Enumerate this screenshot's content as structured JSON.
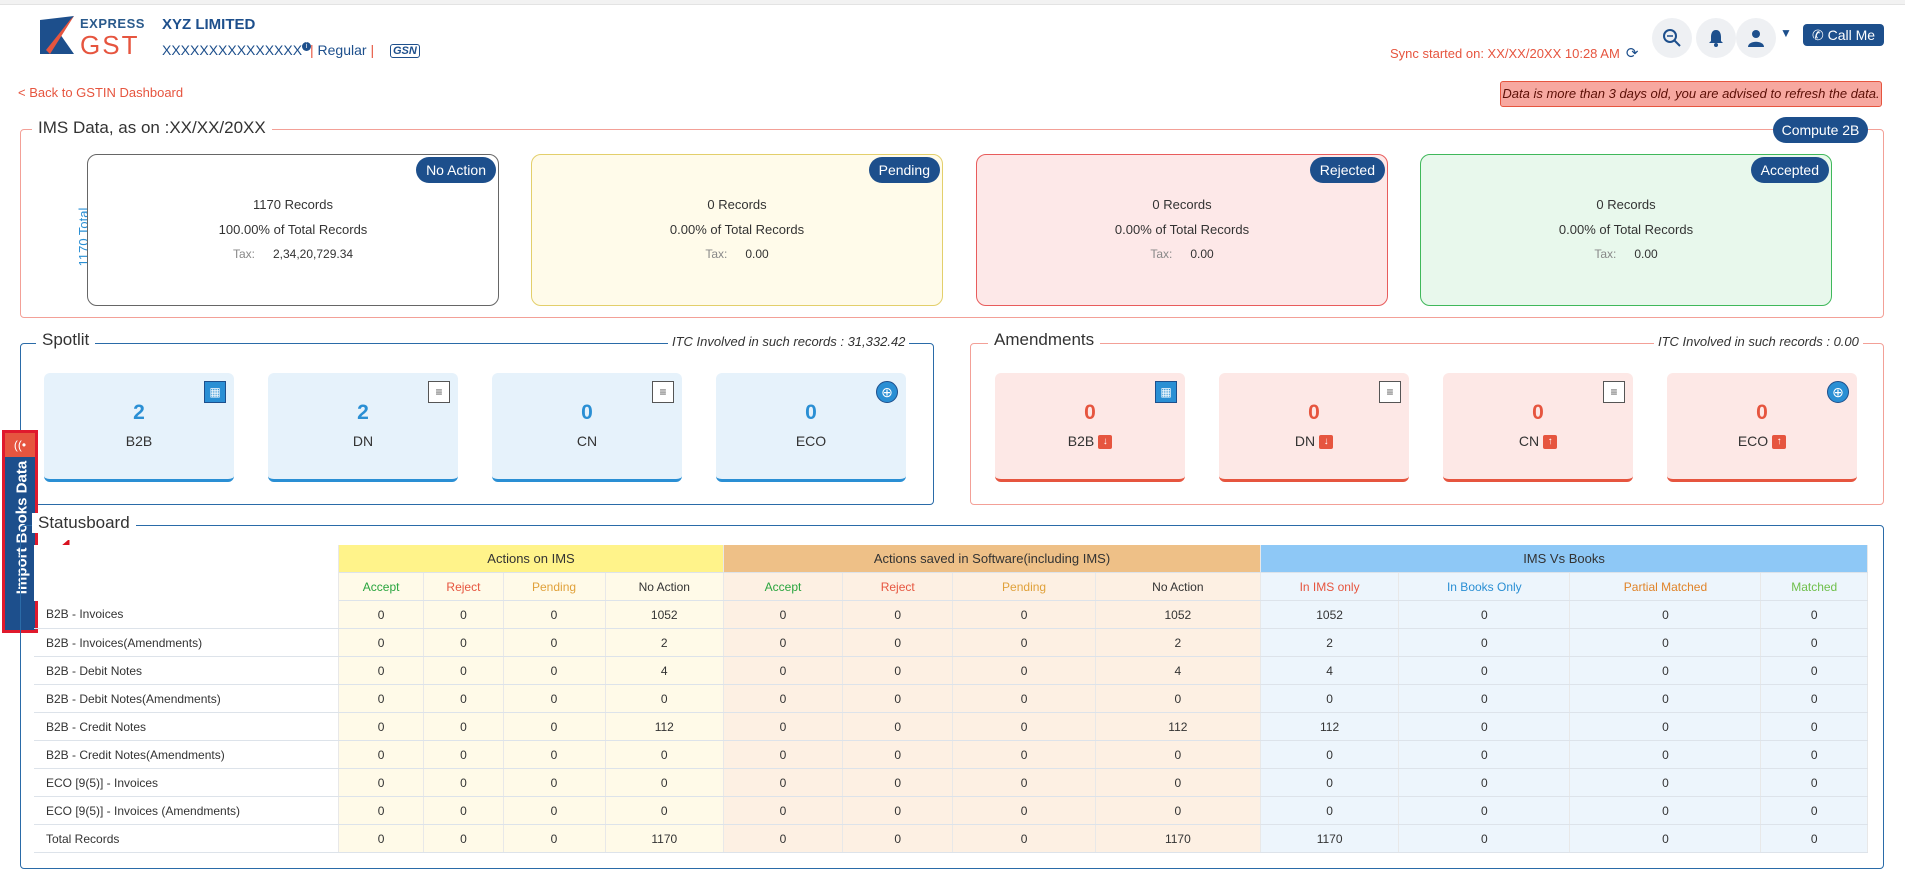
{
  "header": {
    "logo_top": "EXPRESS",
    "logo_bottom": "GST",
    "company": "XYZ LIMITED",
    "gstin": "XXXXXXXXXXXXXXX",
    "info_icon": "i",
    "sep": "|",
    "type": "Regular",
    "gsn_badge": "GSN",
    "sync": "Sync started on: XX/XX/20XX 10:28 AM",
    "icons": [
      "search-icon",
      "bell-icon",
      "user-icon",
      "chevron-down-icon"
    ],
    "call_label": "Call Me"
  },
  "back_link": "< Back to GSTIN Dashboard",
  "warning": "Data is more than 3 days old, you are advised to refresh the data.",
  "ims": {
    "title": "IMS Data, as on :XX/XX/20XX",
    "compute_label": "Compute 2B",
    "total_records": "1170 Total Records",
    "tax_label": "Tax:",
    "cards": [
      {
        "badge": "No Action",
        "records": "1170 Records",
        "percent": "100.00% of Total Records",
        "tax": "2,34,20,729.34",
        "bg": "#ffffff",
        "border": "#666666"
      },
      {
        "badge": "Pending",
        "records": "0 Records",
        "percent": "0.00% of Total Records",
        "tax": "0.00",
        "bg": "#fffbea",
        "border": "#e3cf6b"
      },
      {
        "badge": "Rejected",
        "records": "0 Records",
        "percent": "0.00% of Total Records",
        "tax": "0.00",
        "bg": "#fde8e8",
        "border": "#e85c5c"
      },
      {
        "badge": "Accepted",
        "records": "0 Records",
        "percent": "0.00% of Total Records",
        "tax": "0.00",
        "bg": "#e8f8ec",
        "border": "#3fb85a"
      }
    ]
  },
  "spotlit": {
    "title": "Spotlit",
    "itc": "ITC Involved in such records : 31,332.42",
    "tiles": [
      {
        "value": "2",
        "label": "B2B",
        "icon": "building-icon"
      },
      {
        "value": "2",
        "label": "DN",
        "icon": "document-icon"
      },
      {
        "value": "0",
        "label": "CN",
        "icon": "document-icon"
      },
      {
        "value": "0",
        "label": "ECO",
        "icon": "globe-icon"
      }
    ]
  },
  "amendments": {
    "title": "Amendments",
    "itc": "ITC Involved in such records : 0.00",
    "tiles": [
      {
        "value": "0",
        "label": "B2B",
        "icon": "building-icon",
        "arrow": "arrow-down-icon"
      },
      {
        "value": "0",
        "label": "DN",
        "icon": "document-icon",
        "arrow": "arrow-down-icon"
      },
      {
        "value": "0",
        "label": "CN",
        "icon": "document-icon",
        "arrow": "arrow-up-icon"
      },
      {
        "value": "0",
        "label": "ECO",
        "icon": "globe-icon",
        "arrow": "arrow-up-icon"
      }
    ]
  },
  "side_tab": "Import Books Data",
  "statusboard": {
    "title": "Statusboard",
    "groups": [
      "Actions on IMS",
      "Actions saved in Software(including IMS)",
      "IMS Vs Books"
    ],
    "columns": [
      "Accept",
      "Reject",
      "Pending",
      "No Action",
      "Accept",
      "Reject",
      "Pending",
      "No Action",
      "In IMS only",
      "In Books Only",
      "Partial Matched",
      "Matched"
    ],
    "rows": [
      {
        "label": "B2B - Invoices",
        "values": [
          "0",
          "0",
          "0",
          "1052",
          "0",
          "0",
          "0",
          "1052",
          "1052",
          "0",
          "0",
          "0"
        ]
      },
      {
        "label": "B2B - Invoices(Amendments)",
        "values": [
          "0",
          "0",
          "0",
          "2",
          "0",
          "0",
          "0",
          "2",
          "2",
          "0",
          "0",
          "0"
        ]
      },
      {
        "label": "B2B - Debit Notes",
        "values": [
          "0",
          "0",
          "0",
          "4",
          "0",
          "0",
          "0",
          "4",
          "4",
          "0",
          "0",
          "0"
        ]
      },
      {
        "label": "B2B - Debit Notes(Amendments)",
        "values": [
          "0",
          "0",
          "0",
          "0",
          "0",
          "0",
          "0",
          "0",
          "0",
          "0",
          "0",
          "0"
        ]
      },
      {
        "label": "B2B - Credit Notes",
        "values": [
          "0",
          "0",
          "0",
          "112",
          "0",
          "0",
          "0",
          "112",
          "112",
          "0",
          "0",
          "0"
        ]
      },
      {
        "label": "B2B - Credit Notes(Amendments)",
        "values": [
          "0",
          "0",
          "0",
          "0",
          "0",
          "0",
          "0",
          "0",
          "0",
          "0",
          "0",
          "0"
        ]
      },
      {
        "label": "ECO [9(5)] - Invoices",
        "values": [
          "0",
          "0",
          "0",
          "0",
          "0",
          "0",
          "0",
          "0",
          "0",
          "0",
          "0",
          "0"
        ]
      },
      {
        "label": "ECO [9(5)] - Invoices (Amendments)",
        "values": [
          "0",
          "0",
          "0",
          "0",
          "0",
          "0",
          "0",
          "0",
          "0",
          "0",
          "0",
          "0"
        ]
      },
      {
        "label": "Total Records",
        "values": [
          "0",
          "0",
          "0",
          "1170",
          "0",
          "0",
          "0",
          "1170",
          "1170",
          "0",
          "0",
          "0"
        ]
      }
    ]
  }
}
